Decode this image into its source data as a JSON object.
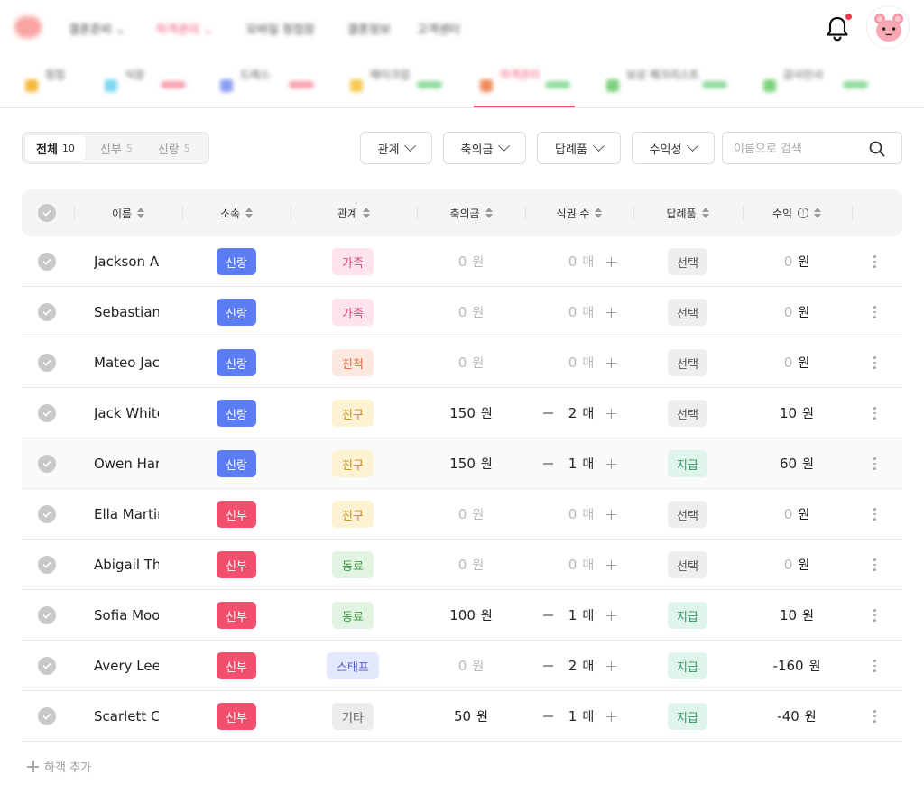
{
  "nav": {
    "items": [
      {
        "label": "결혼준비 ⌄",
        "active": false
      },
      {
        "label": "하객관리 ⌄",
        "active": true
      },
      {
        "label": "모바일 청첩장",
        "active": false
      },
      {
        "label": "결혼정보",
        "active": false
      },
      {
        "label": "고객센터",
        "active": false
      }
    ]
  },
  "subtabs": [
    {
      "label": "청첩",
      "color": "#f6b73c"
    },
    {
      "label": "식장",
      "color": "#7fd6f0"
    },
    {
      "label": "드레스",
      "color": "#8a9cf5"
    },
    {
      "label": "메이크업",
      "color": "#f7c850"
    },
    {
      "label": "하객관리",
      "color": "#f08a5d"
    },
    {
      "label": "보상 체크리스트",
      "color": "#7dd17d"
    },
    {
      "label": "감사인사",
      "color": "#7dd17d"
    }
  ],
  "filter": {
    "segments": [
      {
        "label": "전체",
        "count": "10"
      },
      {
        "label": "신부",
        "count": "5"
      },
      {
        "label": "신랑",
        "count": "5"
      }
    ],
    "dropdowns": [
      {
        "label": "관계"
      },
      {
        "label": "축의금"
      },
      {
        "label": "답례품"
      },
      {
        "label": "수익성"
      }
    ],
    "search_placeholder": "이름으로 검색"
  },
  "table": {
    "headers": {
      "name": "이름",
      "side": "소속",
      "relation": "관계",
      "gift_money": "축의금",
      "meal_tickets": "식권 수",
      "return_gift": "답례품",
      "profit": "수익"
    },
    "unit_won": "원",
    "unit_ticket": "매",
    "rows": [
      {
        "name": "Jackson A",
        "side": "신랑",
        "relation": "가족",
        "gift": "0",
        "tickets": "0",
        "return_gift": "선택",
        "profit": "0"
      },
      {
        "name": "Sebastian",
        "side": "신랑",
        "relation": "가족",
        "gift": "0",
        "tickets": "0",
        "return_gift": "선택",
        "profit": "0"
      },
      {
        "name": "Mateo Jac",
        "side": "신랑",
        "relation": "친척",
        "gift": "0",
        "tickets": "0",
        "return_gift": "선택",
        "profit": "0"
      },
      {
        "name": "Jack White",
        "side": "신랑",
        "relation": "친구",
        "gift": "150",
        "tickets": "2",
        "return_gift": "선택",
        "profit": "10"
      },
      {
        "name": "Owen Har",
        "side": "신랑",
        "relation": "친구",
        "gift": "150",
        "tickets": "1",
        "return_gift": "지급",
        "profit": "60"
      },
      {
        "name": "Ella Martin",
        "side": "신부",
        "relation": "친구",
        "gift": "0",
        "tickets": "0",
        "return_gift": "선택",
        "profit": "0"
      },
      {
        "name": "Abigail Th",
        "side": "신부",
        "relation": "동료",
        "gift": "0",
        "tickets": "0",
        "return_gift": "선택",
        "profit": "0"
      },
      {
        "name": "Sofia Moo",
        "side": "신부",
        "relation": "동료",
        "gift": "100",
        "tickets": "1",
        "return_gift": "지급",
        "profit": "10"
      },
      {
        "name": "Avery Lee",
        "side": "신부",
        "relation": "스태프",
        "gift": "0",
        "tickets": "2",
        "return_gift": "지급",
        "profit": "-160"
      },
      {
        "name": "Scarlett C",
        "side": "신부",
        "relation": "기타",
        "gift": "50",
        "tickets": "1",
        "return_gift": "지급",
        "profit": "-40"
      }
    ]
  },
  "add_guest_label": "하객 추가",
  "colors": {
    "groom": "#5b7cf5",
    "bride": "#f0506e",
    "family_bg": "#fde4ec",
    "family_fg": "#e04876",
    "relative_bg": "#fde8df",
    "relative_fg": "#e0663a",
    "friend_bg": "#fdf3d3",
    "friend_fg": "#c98a12",
    "colleague_bg": "#e1f4e1",
    "colleague_fg": "#3e9b45",
    "staff_bg": "#e4e8fc",
    "staff_fg": "#4a5bd0",
    "etc_bg": "#ececec",
    "etc_fg": "#666666",
    "select_bg": "#eeeeee",
    "select_fg": "#555555",
    "paid_bg": "#dff4ea",
    "paid_fg": "#2f9a63"
  }
}
